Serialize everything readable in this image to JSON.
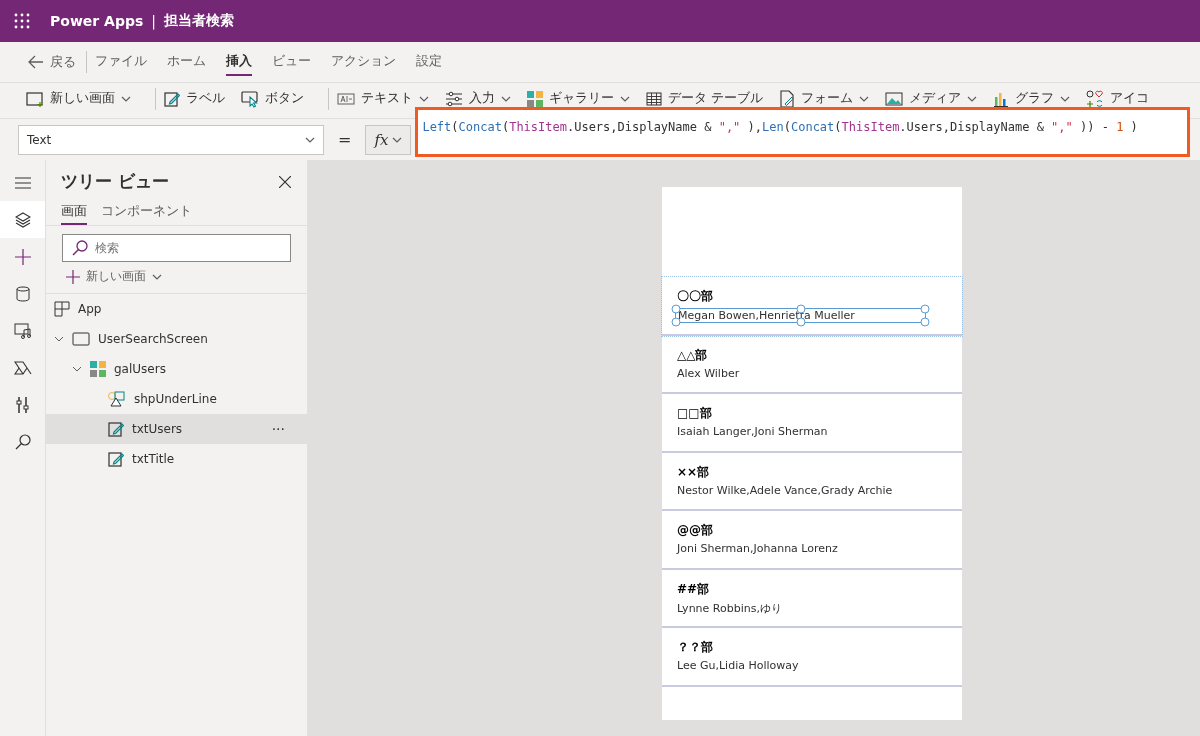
{
  "app_bar": {
    "app_name": "Power Apps",
    "separator": "|",
    "title": "担当者検索"
  },
  "menu": {
    "back": "戻る",
    "tabs": [
      {
        "label": "ファイル",
        "selected": false
      },
      {
        "label": "ホーム",
        "selected": false
      },
      {
        "label": "挿入",
        "selected": true
      },
      {
        "label": "ビュー",
        "selected": false
      },
      {
        "label": "アクション",
        "selected": false
      },
      {
        "label": "設定",
        "selected": false
      }
    ]
  },
  "toolbar": [
    {
      "kind": "screen",
      "label": "新しい画面",
      "dropdown": true
    },
    {
      "kind": "label",
      "label": "ラベル",
      "dropdown": false
    },
    {
      "kind": "button",
      "label": "ボタン",
      "dropdown": false
    },
    {
      "kind": "text",
      "label": "テキスト",
      "dropdown": true
    },
    {
      "kind": "input",
      "label": "入力",
      "dropdown": true
    },
    {
      "kind": "gallery",
      "label": "ギャラリー",
      "dropdown": true
    },
    {
      "kind": "table",
      "label": "データ テーブル",
      "dropdown": false
    },
    {
      "kind": "form",
      "label": "フォーム",
      "dropdown": true
    },
    {
      "kind": "media",
      "label": "メディア",
      "dropdown": true
    },
    {
      "kind": "chart",
      "label": "グラフ",
      "dropdown": true
    },
    {
      "kind": "icons",
      "label": "アイコ",
      "dropdown": false
    }
  ],
  "formula_bar": {
    "property": "Text",
    "equals": "=",
    "fx": "fx",
    "tokens": [
      {
        "kind": "fn",
        "text": "Left"
      },
      {
        "kind": "punc",
        "text": "("
      },
      {
        "kind": "fn",
        "text": "Concat"
      },
      {
        "kind": "punc",
        "text": "("
      },
      {
        "kind": "ident",
        "text": "ThisItem"
      },
      {
        "kind": "punc",
        "text": ".Users,DisplayName & "
      },
      {
        "kind": "str",
        "text": "\",\""
      },
      {
        "kind": "punc",
        "text": " ),"
      },
      {
        "kind": "fn",
        "text": "Len"
      },
      {
        "kind": "punc",
        "text": "("
      },
      {
        "kind": "fn",
        "text": "Concat"
      },
      {
        "kind": "punc",
        "text": "("
      },
      {
        "kind": "ident",
        "text": "ThisItem"
      },
      {
        "kind": "punc",
        "text": ".Users,DisplayName & "
      },
      {
        "kind": "str",
        "text": "\",\""
      },
      {
        "kind": "punc",
        "text": " )) - "
      },
      {
        "kind": "num",
        "text": "1"
      },
      {
        "kind": "punc",
        "text": " )"
      }
    ]
  },
  "rail": [
    {
      "kind": "menu",
      "selected": false
    },
    {
      "kind": "layers",
      "selected": true
    },
    {
      "kind": "plus",
      "selected": false
    },
    {
      "kind": "data",
      "selected": false
    },
    {
      "kind": "media",
      "selected": false
    },
    {
      "kind": "flow",
      "selected": false
    },
    {
      "kind": "tools",
      "selected": false
    },
    {
      "kind": "search",
      "selected": false
    }
  ],
  "tree_view": {
    "title": "ツリー ビュー",
    "tabs": [
      {
        "label": "画面",
        "selected": true
      },
      {
        "label": "コンポーネント",
        "selected": false
      }
    ],
    "search": {
      "placeholder": "検索"
    },
    "new_screen": "新しい画面",
    "items": [
      {
        "kind": "app",
        "label": "App",
        "selected": false
      },
      {
        "kind": "screen",
        "label": "UserSearchScreen",
        "selected": false,
        "expanded": true,
        "children": [
          {
            "kind": "gallery",
            "label": "galUsers",
            "selected": false,
            "expanded": true,
            "children": [
              {
                "kind": "shape",
                "label": "shpUnderLine",
                "selected": false
              },
              {
                "kind": "label",
                "label": "txtUsers",
                "selected": true,
                "more": "···"
              },
              {
                "kind": "label",
                "label": "txtTitle",
                "selected": false
              }
            ]
          }
        ]
      }
    ]
  },
  "gallery": [
    {
      "title": "〇〇部",
      "users": "Megan Bowen,Henrietta Mueller",
      "selected": true
    },
    {
      "title": "△△部",
      "users": "Alex Wilber",
      "selected": false
    },
    {
      "title": "□□部",
      "users": "Isaiah Langer,Joni Sherman",
      "selected": false
    },
    {
      "title": "××部",
      "users": "Nestor Wilke,Adele Vance,Grady Archie",
      "selected": false
    },
    {
      "title": "@@部",
      "users": "Joni Sherman,Johanna Lorenz",
      "selected": false
    },
    {
      "title": "##部",
      "users": "Lynne Robbins,ゆり",
      "selected": false
    },
    {
      "title": "？？部",
      "users": "Lee Gu,Lidia Holloway",
      "selected": false
    }
  ]
}
